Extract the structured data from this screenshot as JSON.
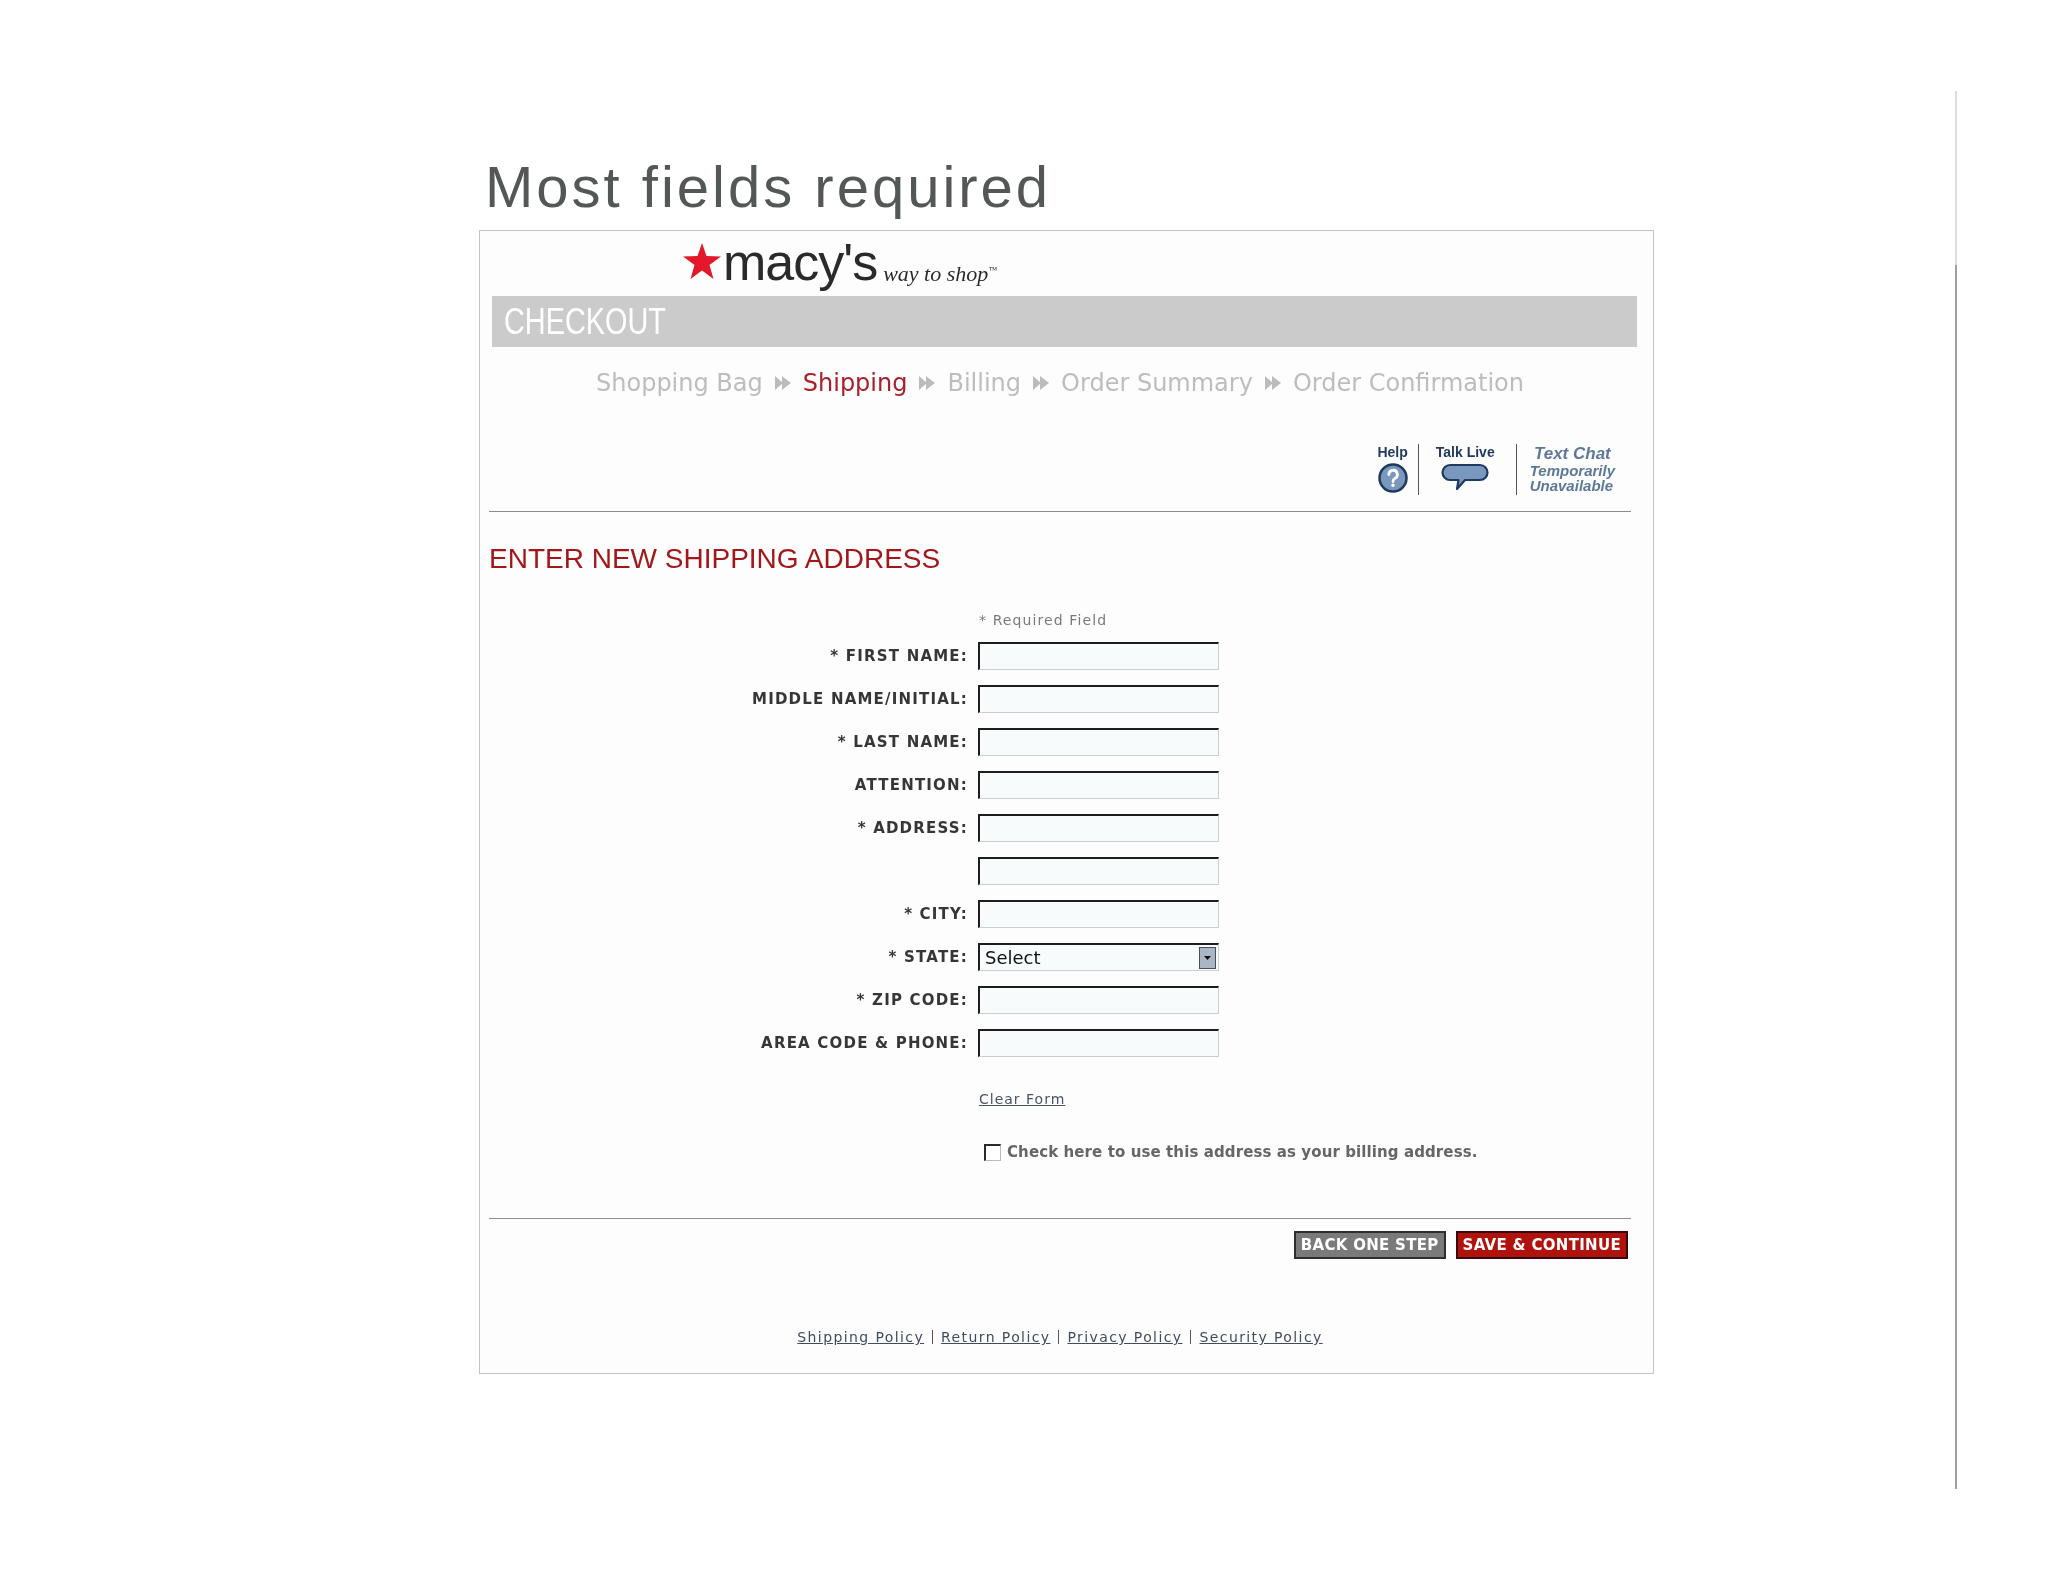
{
  "slide": {
    "title": "Most fields required"
  },
  "logo": {
    "brand": "macy's",
    "tagline": "way to shop$^{™}$"
  },
  "checkout_bar": {
    "title": "CHECKOUT"
  },
  "steps": [
    {
      "label": "Shopping Bag",
      "selected": false
    },
    {
      "label": "Shipping",
      "selected": true
    },
    {
      "label": "Billing",
      "selected": false
    },
    {
      "label": "Order Summary",
      "selected": false
    },
    {
      "label": "Order Confirmation",
      "selected": false
    }
  ],
  "support": [
    {
      "kind": "help",
      "label": "Help"
    },
    {
      "kind": "talk",
      "label": "Talk Live"
    },
    {
      "kind": "chat",
      "label": "Text Chat",
      "status": "Temporarily Unavailable"
    }
  ],
  "form": {
    "heading": "ENTER NEW SHIPPING ADDRESS",
    "note": "* Required Field",
    "fields": [
      {
        "kind": "text",
        "label": "* FIRST NAME:"
      },
      {
        "kind": "text",
        "label": "MIDDLE NAME/INITIAL:"
      },
      {
        "kind": "text",
        "label": "* LAST NAME:"
      },
      {
        "kind": "text",
        "label": "ATTENTION:"
      },
      {
        "kind": "text",
        "label": "* ADDRESS:"
      },
      {
        "kind": "text"
      },
      {
        "kind": "text",
        "label": "* CITY:"
      },
      {
        "kind": "select",
        "label": "* STATE:",
        "value": "Select"
      },
      {
        "kind": "text",
        "label": "* ZIP CODE:"
      },
      {
        "kind": "text",
        "label": "AREA CODE & PHONE:"
      }
    ],
    "clear_link": "Clear Form",
    "billing_checkbox": {
      "label": "Check here to use this address as your billing address.",
      "checked": false
    }
  },
  "buttons": [
    {
      "kind": "secondary",
      "label": "BACK ONE STEP"
    },
    {
      "kind": "primary",
      "label": "SAVE & CONTINUE"
    }
  ],
  "footer_links": [
    "Shipping Policy",
    "Return Policy",
    "Privacy Policy",
    "Security Policy"
  ]
}
